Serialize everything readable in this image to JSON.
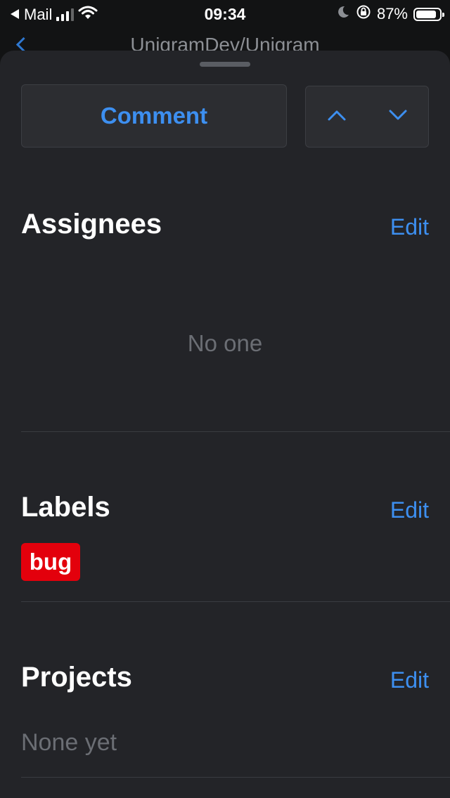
{
  "status_bar": {
    "back_app": "Mail",
    "time": "09:34",
    "battery": "87%",
    "battery_level": 0.87,
    "icons": [
      "back-triangle-icon",
      "cellular-signal-icon",
      "wifi-icon",
      "moon-icon",
      "orientation-lock-icon",
      "battery-icon"
    ]
  },
  "background_nav": {
    "title": "UnigramDev/Unigram",
    "back_icon": "chevron-left-icon"
  },
  "toolbar": {
    "comment_label": "Comment",
    "prev_icon": "chevron-up-icon",
    "next_icon": "chevron-down-icon"
  },
  "sections": {
    "assignees": {
      "title": "Assignees",
      "edit_label": "Edit",
      "empty_text": "No one"
    },
    "labels": {
      "title": "Labels",
      "edit_label": "Edit",
      "items": [
        {
          "name": "bug",
          "color": "#e3000c"
        }
      ]
    },
    "projects": {
      "title": "Projects",
      "edit_label": "Edit",
      "empty_text": "None yet"
    }
  },
  "colors": {
    "accent": "#3d8ff0",
    "sheet_background": "#232428",
    "muted_text": "#6b6e74"
  }
}
